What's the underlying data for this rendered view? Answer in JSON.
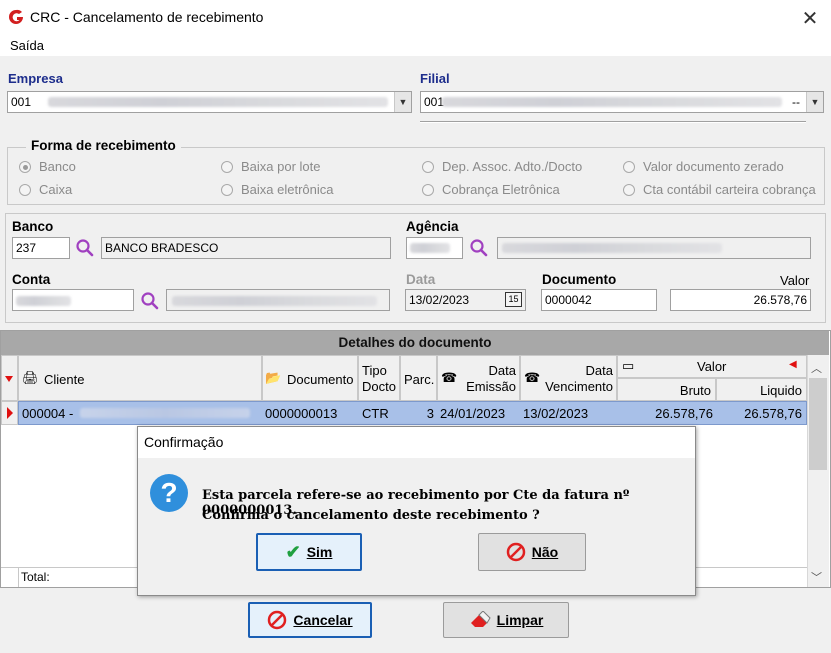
{
  "window": {
    "title": "CRC - Cancelamento de recebimento"
  },
  "menu": {
    "saida": "Saída"
  },
  "empresa": {
    "label": "Empresa",
    "code": "001"
  },
  "filial": {
    "label": "Filial",
    "code": "001",
    "suffix": "--"
  },
  "forma": {
    "title": "Forma de recebimento",
    "options": [
      "Banco",
      "Baixa por lote",
      "Dep. Assoc. Adto./Docto",
      "Valor documento zerado",
      "Caixa",
      "Baixa eletrônica",
      "Cobrança Eletrônica",
      "Cta contábil carteira cobrança"
    ],
    "selected": "Banco"
  },
  "banco": {
    "label": "Banco",
    "code": "237",
    "name": "BANCO BRADESCO"
  },
  "agencia": {
    "label": "Agência"
  },
  "conta": {
    "label": "Conta"
  },
  "data": {
    "label": "Data",
    "value": "13/02/2023"
  },
  "documento": {
    "label": "Documento",
    "value": "0000042"
  },
  "valor": {
    "label": "Valor",
    "value": "26.578,76"
  },
  "detalhes": {
    "title": "Detalhes do documento",
    "columns": {
      "cliente": "Cliente",
      "documento": "Documento",
      "tipo_line1": "Tipo",
      "tipo_line2": "Docto",
      "parc": "Parc.",
      "emissao_line1": "Data",
      "emissao_line2": "Emissão",
      "venc_line1": "Data",
      "venc_line2": "Vencimento",
      "valor": "Valor",
      "bruto": "Bruto",
      "liquido": "Liquido"
    },
    "row": {
      "cliente": "000004 -",
      "documento": "0000000013",
      "tipo": "CTR",
      "parc": "3",
      "emissao": "24/01/2023",
      "vencimento": "13/02/2023",
      "bruto": "26.578,76",
      "liquido": "26.578,76"
    },
    "total_label": "Total:"
  },
  "buttons": {
    "cancelar": "Cancelar",
    "limpar": "Limpar"
  },
  "dialog": {
    "title": "Confirmação",
    "line1": "Esta parcela refere-se ao recebimento por Cte da fatura nº 0000000013.",
    "line2": "Confirma o cancelamento deste recebimento ?",
    "sim": "Sim",
    "nao": "Não"
  },
  "colors": {
    "label_blue": "#1d2d8c",
    "selection": "#a8c0e8",
    "accent": "#1a5fb4"
  }
}
